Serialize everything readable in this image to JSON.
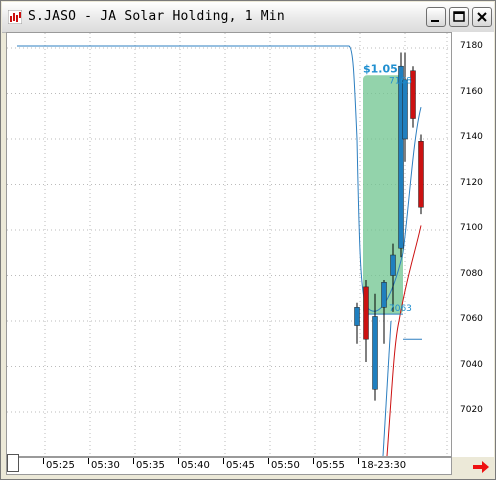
{
  "window": {
    "title": "S.JASO - JA Solar Holding, 1 Min",
    "buttons": [
      "minimize",
      "maximize",
      "close"
    ]
  },
  "chart": {
    "price_ticks": [
      "7180",
      "7160",
      "7140",
      "7120",
      "7100",
      "7080",
      "7060",
      "7040",
      "7020"
    ],
    "time_ticks": [
      "05:25",
      "05:30",
      "05:35",
      "05:40",
      "05:45",
      "05:50",
      "05:55",
      "18-23:30"
    ],
    "annotations": {
      "range_label": "$1.05",
      "high_label": "7168",
      "low_label": "7063"
    },
    "colors": {
      "up": "#1f7fbf",
      "down": "#cc1111",
      "highlight": "#6fc48f",
      "ma_blue": "#2d7fc0",
      "ma_red": "#cc1111"
    }
  },
  "chart_data": {
    "type": "candlestick",
    "ylim": [
      7005,
      7190
    ],
    "candles": [
      {
        "open": 7058,
        "high": 7068,
        "low": 7050,
        "close": 7066,
        "color": "up"
      },
      {
        "open": 7075,
        "high": 7078,
        "low": 7042,
        "close": 7052,
        "color": "down"
      },
      {
        "open": 7030,
        "high": 7072,
        "low": 7025,
        "close": 7062,
        "color": "up"
      },
      {
        "open": 7066,
        "high": 7078,
        "low": 7050,
        "close": 7077,
        "color": "up"
      },
      {
        "open": 7080,
        "high": 7094,
        "low": 7064,
        "close": 7089,
        "color": "up"
      },
      {
        "open": 7092,
        "high": 7178,
        "low": 7088,
        "close": 7172,
        "color": "up"
      },
      {
        "open": 7140,
        "high": 7178,
        "low": 7130,
        "close": 7166,
        "color": "up"
      },
      {
        "open": 7170,
        "high": 7172,
        "low": 7145,
        "close": 7149,
        "color": "down"
      },
      {
        "open": 7139,
        "high": 7142,
        "low": 7107,
        "close": 7110,
        "color": "down"
      }
    ]
  },
  "footer": {
    "arrow_icon": "red-right-arrow-icon"
  }
}
